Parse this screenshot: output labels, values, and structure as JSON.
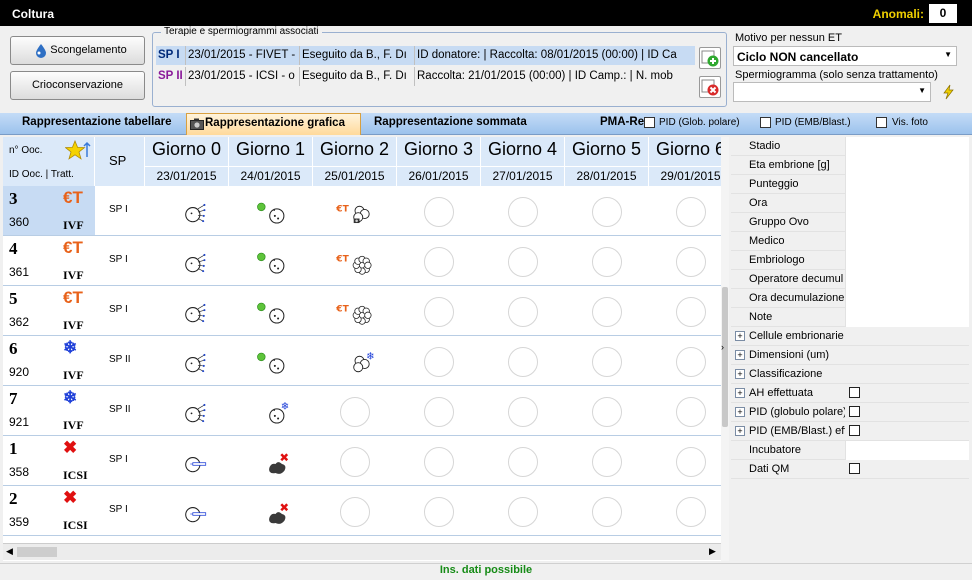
{
  "window": {
    "title": "Coltura",
    "anomali_label": "Anomali:",
    "anomali_value": "0"
  },
  "buttons": {
    "scongelamento": "Scongelamento",
    "crioconservazione": "Crioconservazione"
  },
  "assoc": {
    "legend": "Terapie e spermiogrammi associati",
    "rows": [
      {
        "code": "SP I",
        "therapy": "23/01/2015 - FIVET -",
        "by": "Eseguito da B., F. Dı",
        "info": "ID donatore:  | Raccolta: 08/01/2015 (00:00)  | ID Ca"
      },
      {
        "code": "SP II",
        "therapy": "23/01/2015 - ICSI - o",
        "by": "Eseguito da B., F. Dı",
        "info": "Raccolta: 21/01/2015 (00:00)  | ID Camp.:  | N. mob"
      }
    ]
  },
  "right": {
    "motivo_label": "Motivo per nessun ET",
    "motivo_value": "Ciclo NON cancellato",
    "sperm_label": "Spermiogramma (solo senza trattamento)",
    "sperm_value": ""
  },
  "tabs": {
    "tabellare": "Rappresentazione tabellare",
    "grafica": "Rappresentazione grafica",
    "sommata": "Rappresentazione sommata",
    "pma": "PMA-Re",
    "pid_glob": "PID (Glob. polare)",
    "pid_emb": "PID (EMB/Blast.)",
    "vis_foto": "Vis. foto"
  },
  "grid": {
    "noc": "n° Ooc.",
    "idooc": "ID Ooc. | Tratt.",
    "sp": "SP",
    "days": [
      {
        "label": "Giorno 0",
        "date": "23/01/2015"
      },
      {
        "label": "Giorno 1",
        "date": "24/01/2015"
      },
      {
        "label": "Giorno 2",
        "date": "25/01/2015"
      },
      {
        "label": "Giorno 3",
        "date": "26/01/2015"
      },
      {
        "label": "Giorno 4",
        "date": "27/01/2015"
      },
      {
        "label": "Giorno 5",
        "date": "28/01/2015"
      },
      {
        "label": "Giorno 6",
        "date": "29/01/2015"
      }
    ],
    "rows": [
      {
        "n": "3",
        "id": "360",
        "tr": "IVF",
        "sp": "SP I",
        "status": "et",
        "g0": "ivf",
        "g1": "zygote-green",
        "g2": "et-cells",
        "selected": true
      },
      {
        "n": "4",
        "id": "361",
        "tr": "IVF",
        "sp": "SP I",
        "status": "et",
        "g0": "ivf",
        "g1": "zygote-green",
        "g2": "et-morula"
      },
      {
        "n": "5",
        "id": "362",
        "tr": "IVF",
        "sp": "SP I",
        "status": "et",
        "g0": "ivf",
        "g1": "zygote-green",
        "g2": "et-morula"
      },
      {
        "n": "6",
        "id": "920",
        "tr": "IVF",
        "sp": "SP II",
        "status": "frozen",
        "g0": "ivf",
        "g1": "zygote-green",
        "g2": "cells-frozen"
      },
      {
        "n": "7",
        "id": "921",
        "tr": "IVF",
        "sp": "SP II",
        "status": "frozen",
        "g0": "ivf",
        "g1": "zygote-frozen",
        "g2": "empty"
      },
      {
        "n": "1",
        "id": "358",
        "tr": "ICSI",
        "sp": "SP I",
        "status": "discarded",
        "g0": "icsi",
        "g1": "degenerated",
        "g2": "empty"
      },
      {
        "n": "2",
        "id": "359",
        "tr": "ICSI",
        "sp": "SP I",
        "status": "discarded",
        "g0": "icsi",
        "g1": "degenerated",
        "g2": "empty"
      }
    ]
  },
  "details": [
    {
      "label": "Stadio",
      "expand": false,
      "check": false
    },
    {
      "label": "Eta embrione [g]",
      "expand": false,
      "check": false
    },
    {
      "label": "Punteggio",
      "expand": false,
      "check": false
    },
    {
      "label": "Ora",
      "expand": false,
      "check": false
    },
    {
      "label": "Gruppo Ovo",
      "expand": false,
      "check": false
    },
    {
      "label": "Medico",
      "expand": false,
      "check": false
    },
    {
      "label": "Embriologo",
      "expand": false,
      "check": false
    },
    {
      "label": "Operatore decumul",
      "expand": false,
      "check": false
    },
    {
      "label": "Ora decumulazione",
      "expand": false,
      "check": false
    },
    {
      "label": "Note",
      "expand": false,
      "check": false
    },
    {
      "label": "Cellule embrionarie",
      "expand": true,
      "check": false
    },
    {
      "label": "Dimensioni (um)",
      "expand": true,
      "check": false
    },
    {
      "label": "Classificazione",
      "expand": true,
      "check": false
    },
    {
      "label": "AH effettuata",
      "expand": true,
      "check": true
    },
    {
      "label": "PID (globulo polare)",
      "expand": true,
      "check": true
    },
    {
      "label": "PID (EMB/Blast.) eff",
      "expand": true,
      "check": true
    },
    {
      "label": "Incubatore",
      "expand": false,
      "check": false
    },
    {
      "label": "Dati QM",
      "expand": false,
      "check": true
    }
  ],
  "status_text": "Ins. dati possibile",
  "colors": {
    "accent": "#f0d000",
    "et": "#e8621a",
    "frozen": "#1e3fd8",
    "discard": "#e01010",
    "status": "#168b16"
  }
}
